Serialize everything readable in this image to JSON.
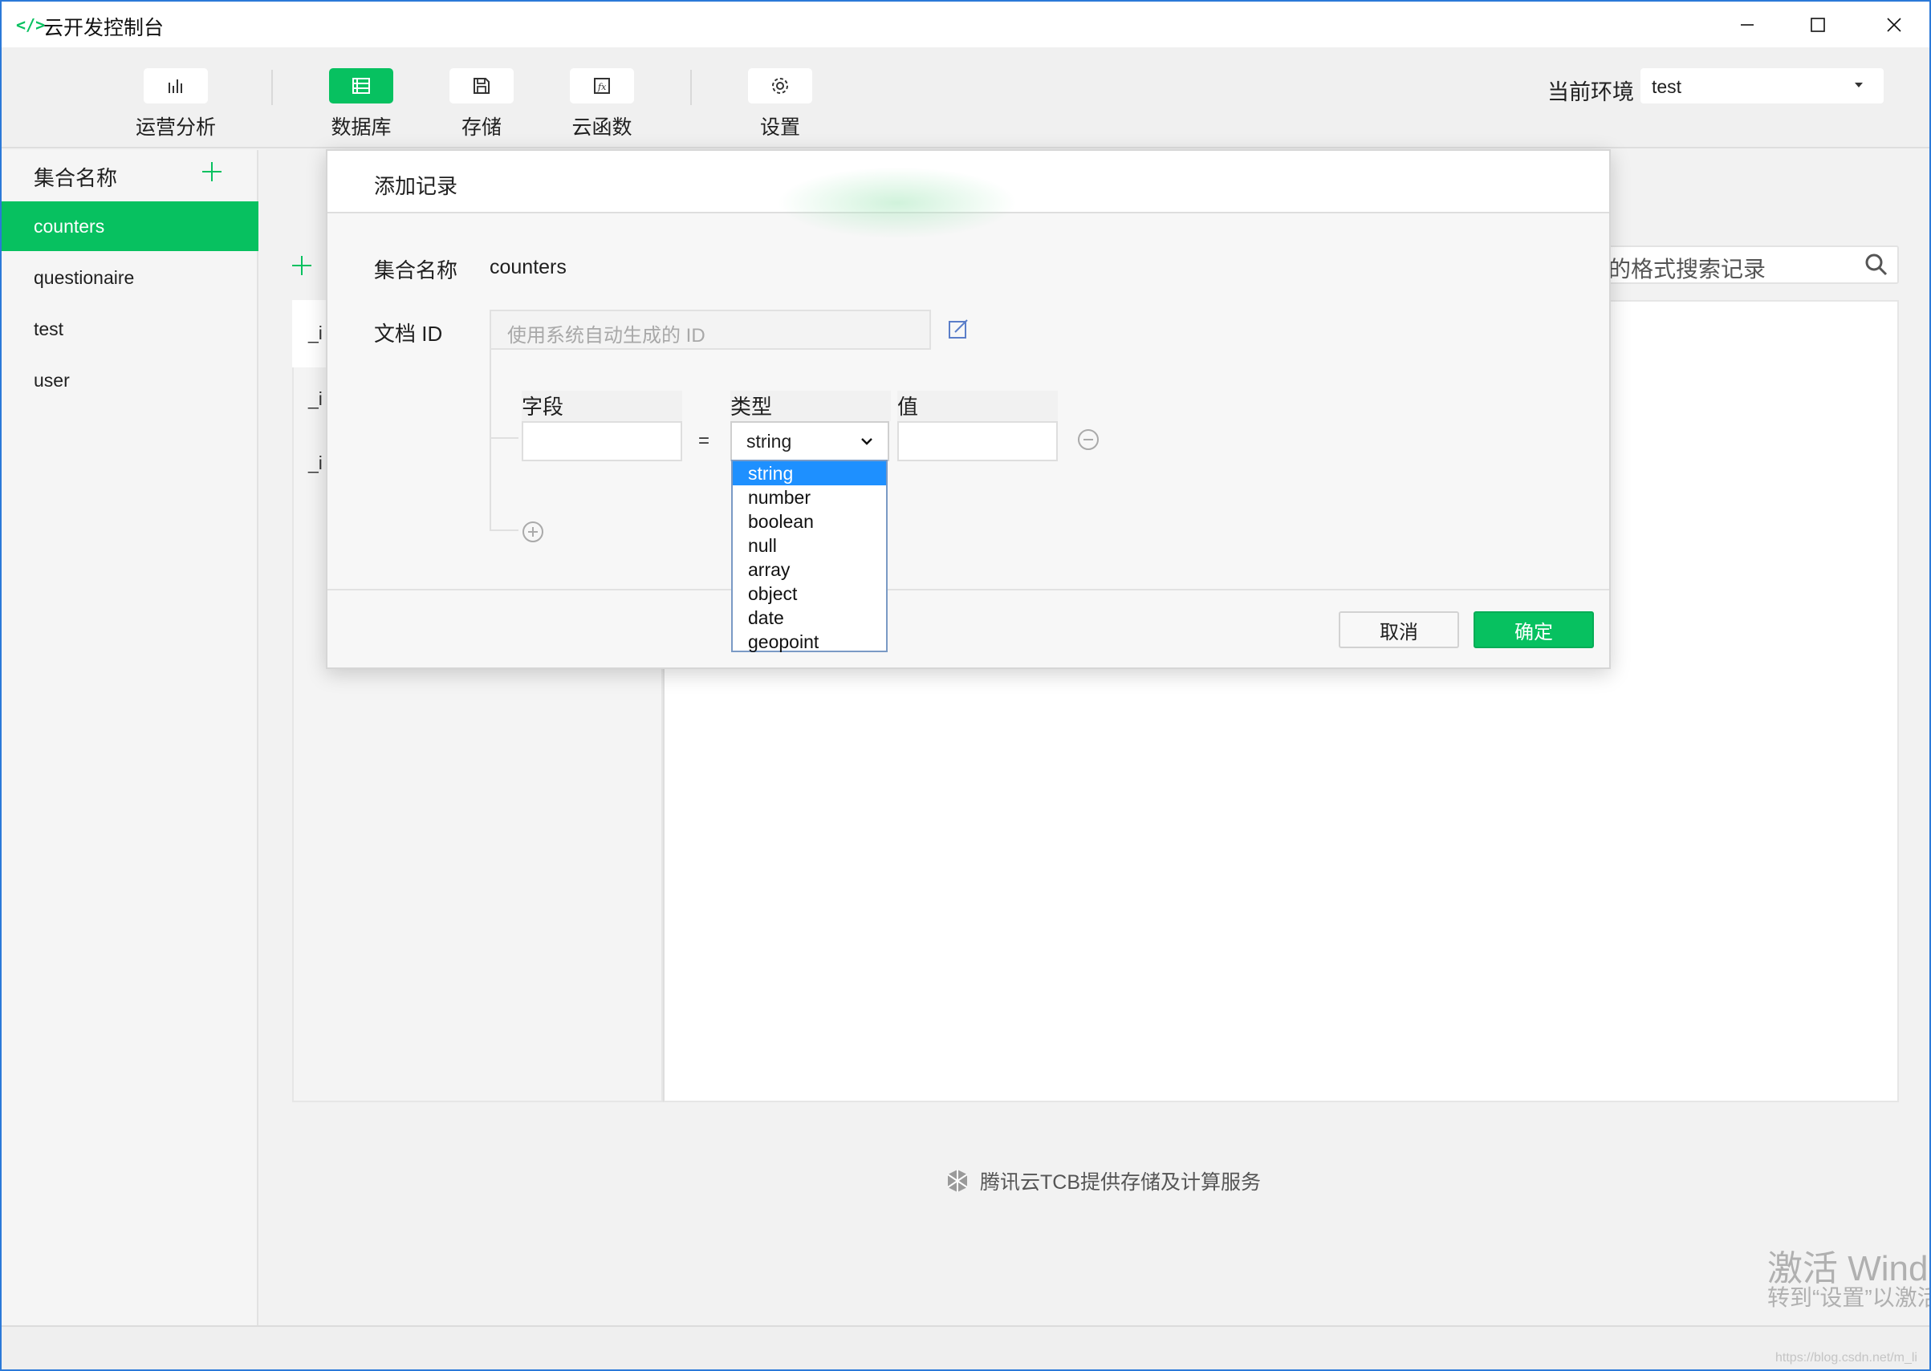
{
  "window": {
    "title": "云开发控制台",
    "app_icon": "</>"
  },
  "toolbar": {
    "tools": [
      {
        "label": "运营分析",
        "icon": "bar-chart-icon"
      },
      {
        "label": "数据库",
        "icon": "database-icon",
        "active": true
      },
      {
        "label": "存储",
        "icon": "save-icon"
      },
      {
        "label": "云函数",
        "icon": "function-icon"
      },
      {
        "label": "设置",
        "icon": "gear-icon"
      }
    ],
    "env_label": "当前环境",
    "env_value": "test"
  },
  "sidebar": {
    "header": "集合名称",
    "items": [
      {
        "label": "counters",
        "active": true
      },
      {
        "label": "questionaire"
      },
      {
        "label": "test"
      },
      {
        "label": "user"
      }
    ]
  },
  "main": {
    "search_placeholder_fragment": "的格式搜索记录",
    "row_fragments": [
      "_i",
      "_i",
      "_i"
    ],
    "footer": "腾讯云TCB提供存储及计算服务"
  },
  "modal": {
    "title": "添加记录",
    "collection_label": "集合名称",
    "collection_value": "counters",
    "doc_id_label": "文档 ID",
    "doc_id_placeholder": "使用系统自动生成的 ID",
    "field_header": "字段",
    "type_header": "类型",
    "value_header": "值",
    "equals": "=",
    "type_selected": "string",
    "type_options": [
      "string",
      "number",
      "boolean",
      "null",
      "array",
      "object",
      "date",
      "geopoint"
    ],
    "cancel": "取消",
    "confirm": "确定"
  },
  "watermark": {
    "line1": "激活 Windo",
    "line2": "转到“设置”以激活",
    "url": "https://blog.csdn.net/m_li"
  },
  "colors": {
    "accent": "#07c160",
    "selection": "#1e90ff",
    "window_border": "#2b79d8"
  }
}
